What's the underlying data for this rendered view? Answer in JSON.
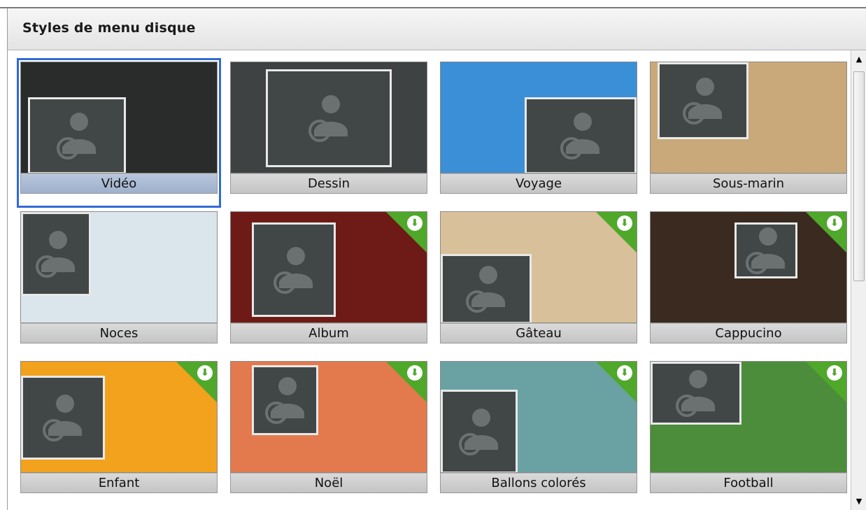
{
  "panel": {
    "title": "Styles de menu disque"
  },
  "styles": [
    {
      "label": "Vidéo",
      "selected": true,
      "download": false,
      "bg": "#2a2c2c"
    },
    {
      "label": "Dessin",
      "selected": false,
      "download": false,
      "bg": "#3e4242"
    },
    {
      "label": "Voyage",
      "selected": false,
      "download": false,
      "bg": "#3b8fd6"
    },
    {
      "label": "Sous-marin",
      "selected": false,
      "download": false,
      "bg": "#c9a97a"
    },
    {
      "label": "Noces",
      "selected": false,
      "download": false,
      "bg": "#dbe6ec"
    },
    {
      "label": "Album",
      "selected": false,
      "download": true,
      "bg": "#6e1b17"
    },
    {
      "label": "Gâteau",
      "selected": false,
      "download": true,
      "bg": "#d8c19a"
    },
    {
      "label": "Cappucino",
      "selected": false,
      "download": true,
      "bg": "#3a2a20"
    },
    {
      "label": "Enfant",
      "selected": false,
      "download": true,
      "bg": "#f2a21c"
    },
    {
      "label": "Noël",
      "selected": false,
      "download": true,
      "bg": "#e37a4d"
    },
    {
      "label": "Ballons colorés",
      "selected": false,
      "download": true,
      "bg": "#6aa2a4"
    },
    {
      "label": "Football",
      "selected": false,
      "download": true,
      "bg": "#4b8d3a"
    }
  ],
  "icons": {
    "placeholder": "person-add-icon",
    "download": "download-arrow-icon",
    "scroll_up": "scroll-up-arrow-icon",
    "scroll_down": "scroll-down-arrow-icon"
  },
  "colors": {
    "selection": "#2f6bd6",
    "download_ribbon": "#4fa82a"
  }
}
